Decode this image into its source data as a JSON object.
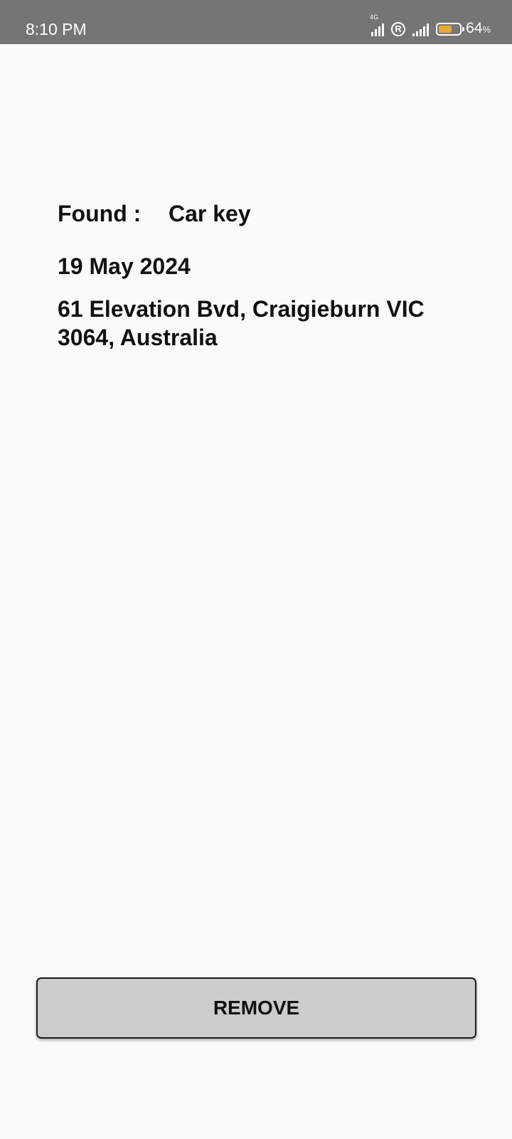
{
  "status_bar": {
    "time": "8:10 PM",
    "network_label": "4G",
    "roaming_label": "R",
    "battery_percent": "64",
    "battery_percent_sign": "%",
    "battery_level": 0.64,
    "battery_color": "#e8a73a"
  },
  "item": {
    "type_label": "Found :",
    "name": "Car key",
    "date": "19 May 2024",
    "address": "61 Elevation Bvd, Craigieburn VIC 3064, Australia"
  },
  "actions": {
    "remove_label": "REMOVE"
  }
}
